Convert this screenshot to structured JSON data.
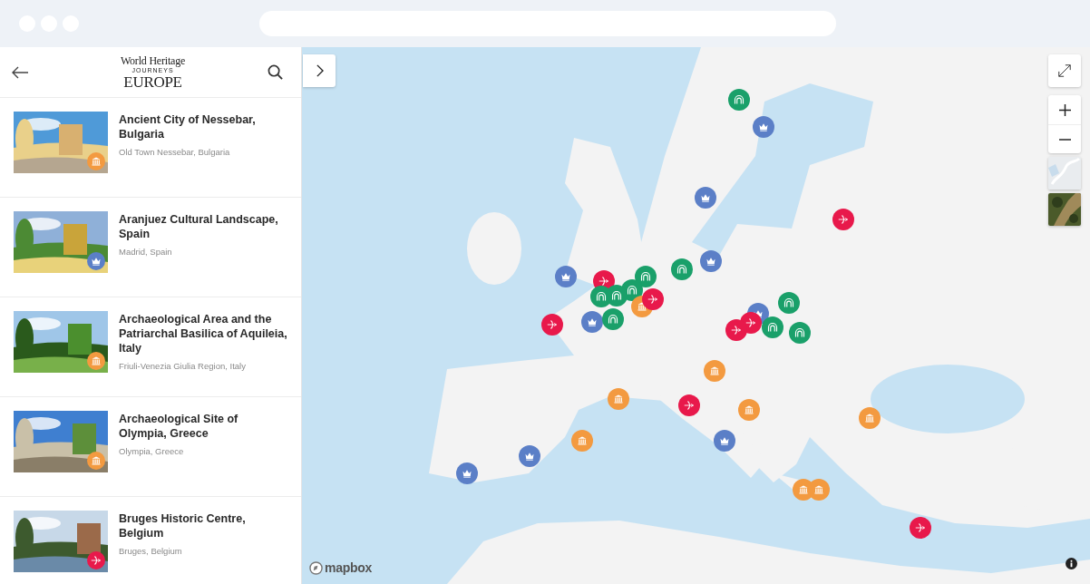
{
  "sidebar": {
    "logo": {
      "line1": "World Heritage",
      "line2": "JOURNEYS",
      "line3": "EUROPE"
    },
    "places": [
      {
        "title": "Ancient City of Nessebar, Bulgaria",
        "location": "Old Town Nessebar, Bulgaria",
        "kind": "temple",
        "color": "#f39a40"
      },
      {
        "title": "Aranjuez Cultural Landscape, Spain",
        "location": "Madrid, Spain",
        "kind": "crown",
        "color": "#5b7fc7"
      },
      {
        "title": "Archaeological Area and the Patriarchal Basilica of Aquileia, Italy",
        "location": "Friuli-Venezia Giulia Region, Italy",
        "kind": "temple",
        "color": "#f39a40"
      },
      {
        "title": "Archaeological Site of Olympia, Greece",
        "location": "Olympia, Greece",
        "kind": "temple",
        "color": "#f39a40"
      },
      {
        "title": "Bruges Historic Centre, Belgium",
        "location": "Bruges, Belgium",
        "kind": "bow",
        "color": "#e8194b"
      }
    ]
  },
  "map": {
    "attribution": "mapbox",
    "markers": [
      {
        "kind": "arch",
        "color": "#1aa06a"
      },
      {
        "kind": "crown",
        "color": "#5b7fc7"
      },
      {
        "kind": "crown",
        "color": "#5b7fc7"
      },
      {
        "kind": "bow",
        "color": "#e8194b"
      },
      {
        "kind": "crown",
        "color": "#5b7fc7"
      },
      {
        "kind": "bow",
        "color": "#e8194b"
      },
      {
        "kind": "arch",
        "color": "#1aa06a"
      },
      {
        "kind": "arch",
        "color": "#1aa06a"
      },
      {
        "kind": "crown",
        "color": "#5b7fc7"
      },
      {
        "kind": "arch",
        "color": "#1aa06a"
      },
      {
        "kind": "arch",
        "color": "#1aa06a"
      },
      {
        "kind": "arch",
        "color": "#1aa06a"
      },
      {
        "kind": "temple",
        "color": "#f39a40"
      },
      {
        "kind": "bow",
        "color": "#e8194b"
      },
      {
        "kind": "bow",
        "color": "#e8194b"
      },
      {
        "kind": "crown",
        "color": "#5b7fc7"
      },
      {
        "kind": "arch",
        "color": "#1aa06a"
      },
      {
        "kind": "crown",
        "color": "#5b7fc7"
      },
      {
        "kind": "bow",
        "color": "#e8194b"
      },
      {
        "kind": "bow",
        "color": "#e8194b"
      },
      {
        "kind": "arch",
        "color": "#1aa06a"
      },
      {
        "kind": "arch",
        "color": "#1aa06a"
      },
      {
        "kind": "arch",
        "color": "#1aa06a"
      },
      {
        "kind": "temple",
        "color": "#f39a40"
      },
      {
        "kind": "temple",
        "color": "#f39a40"
      },
      {
        "kind": "bow",
        "color": "#e8194b"
      },
      {
        "kind": "temple",
        "color": "#f39a40"
      },
      {
        "kind": "temple",
        "color": "#f39a40"
      },
      {
        "kind": "crown",
        "color": "#5b7fc7"
      },
      {
        "kind": "crown",
        "color": "#5b7fc7"
      },
      {
        "kind": "temple",
        "color": "#f39a40"
      },
      {
        "kind": "crown",
        "color": "#5b7fc7"
      },
      {
        "kind": "temple",
        "color": "#f39a40"
      },
      {
        "kind": "temple",
        "color": "#f39a40"
      },
      {
        "kind": "bow",
        "color": "#e8194b"
      }
    ]
  }
}
